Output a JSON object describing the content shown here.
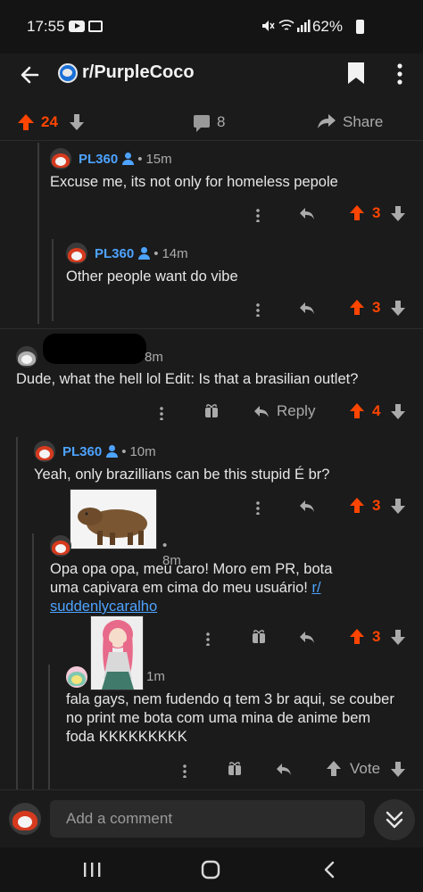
{
  "status_bar": {
    "time": "17:55",
    "battery": "62%",
    "icons": [
      "youtube-icon",
      "gallery-icon",
      "mute-icon",
      "wifi-icon",
      "signal-icon",
      "battery-icon"
    ]
  },
  "header": {
    "subreddit": "r/PurpleCoco",
    "icons": [
      "back-arrow-icon",
      "subreddit-icon",
      "bookmark-icon",
      "more-vertical-icon"
    ]
  },
  "post_actions": {
    "score": "24",
    "comment_count": "8",
    "share_label": "Share"
  },
  "comments": [
    {
      "author": "PL360",
      "age": "15m",
      "body": "Excuse me, its not only for homeless pepole",
      "score": "3"
    },
    {
      "author": "PL360",
      "age": "14m",
      "body": "Other people want do vibe",
      "score": "3"
    },
    {
      "author": "",
      "age": "8m",
      "body": "Dude, what the hell lol Edit: Is that a brasilian outlet?",
      "reply_label": "Reply",
      "score": "4"
    },
    {
      "author": "PL360",
      "age": "10m",
      "body": "Yeah, only brazillians can be this stupid É br?",
      "score": "3"
    },
    {
      "author": "",
      "age": "8m",
      "body_line1": "Opa opa opa, meu caro! Moro em PR, bota",
      "body_line2": "uma capivara em cima do meu usuário!",
      "link_line1": "r/",
      "link_line2": "suddenlycaralho",
      "score": "3"
    },
    {
      "author": "",
      "age": "1m",
      "body_line1": "fala gays, nem fudendo q tem 3 br aqui, se couber",
      "body_line2": "no print me bota com uma mina de anime bem",
      "body_line3": "foda KKKKKKKKK",
      "vote_label": "Vote"
    }
  ],
  "bottom_bar": {
    "comment_placeholder": "Add a comment"
  },
  "colors": {
    "background": "#1b1b1b",
    "upvote": "#ff4500",
    "author": "#4da3ff",
    "muted": "#aaaaaa"
  }
}
